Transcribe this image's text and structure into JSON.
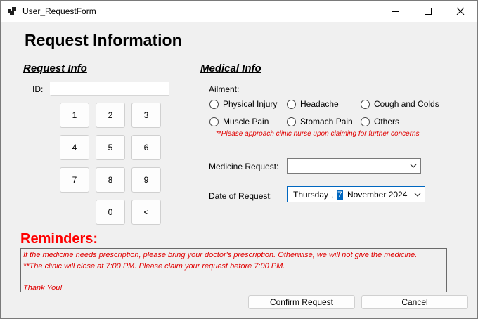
{
  "window": {
    "title": "User_RequestForm"
  },
  "heading": "Request Information",
  "request_info": {
    "title": "Request Info",
    "id_label": "ID:",
    "id_value": "",
    "keypad": [
      "1",
      "2",
      "3",
      "4",
      "5",
      "6",
      "7",
      "8",
      "9",
      "0",
      "<"
    ]
  },
  "medical_info": {
    "title": "Medical Info",
    "ailment_label": "Ailment:",
    "ailments": [
      "Physical Injury",
      "Headache",
      "Cough and Colds",
      "Muscle Pain",
      "Stomach Pain",
      "Others"
    ],
    "note": "**Please approach clinic nurse upon claiming for further concerns",
    "medicine_label": "Medicine Request:",
    "medicine_value": "",
    "date_label": "Date of Request:",
    "date": {
      "weekday": "Thursday",
      "sep": ",",
      "day": "7",
      "month_year": "November 2024"
    }
  },
  "reminders": {
    "title": "Reminders:",
    "lines": [
      "If the medicine needs prescription, please bring your doctor's prescription. Otherwise, we will not give the medicine.",
      "**The clinic will close at 7:00 PM. Please claim your request before 7:00 PM.",
      "",
      "Thank You!"
    ]
  },
  "buttons": {
    "confirm": "Confirm Request",
    "cancel": "Cancel"
  },
  "colors": {
    "accent": "#0067c0",
    "reminder": "#ff0000",
    "note": "#e00000"
  },
  "icons": {
    "app": "app-icon",
    "minimize": "minimize-icon",
    "maximize": "maximize-icon",
    "close": "close-icon",
    "dropdown": "chevron-down-icon"
  }
}
